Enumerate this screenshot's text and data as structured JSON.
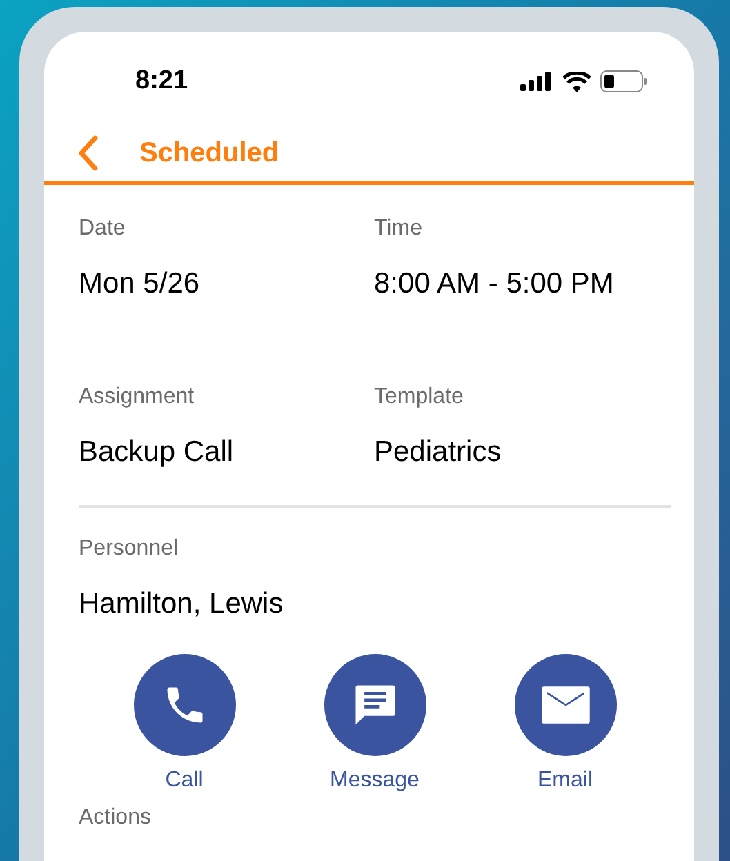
{
  "status_bar": {
    "time": "8:21"
  },
  "header": {
    "title": "Scheduled"
  },
  "details": [
    {
      "label": "Date",
      "value": "Mon 5/26"
    },
    {
      "label": "Time",
      "value": "8:00 AM - 5:00 PM"
    },
    {
      "label": "Assignment",
      "value": "Backup Call"
    },
    {
      "label": "Template",
      "value": "Pediatrics"
    }
  ],
  "personnel": {
    "label": "Personnel",
    "name": "Hamilton, Lewis"
  },
  "contact_actions": [
    {
      "kind": "call",
      "label": "Call"
    },
    {
      "kind": "message",
      "label": "Message"
    },
    {
      "kind": "email",
      "label": "Email"
    }
  ],
  "actions_heading": "Actions"
}
